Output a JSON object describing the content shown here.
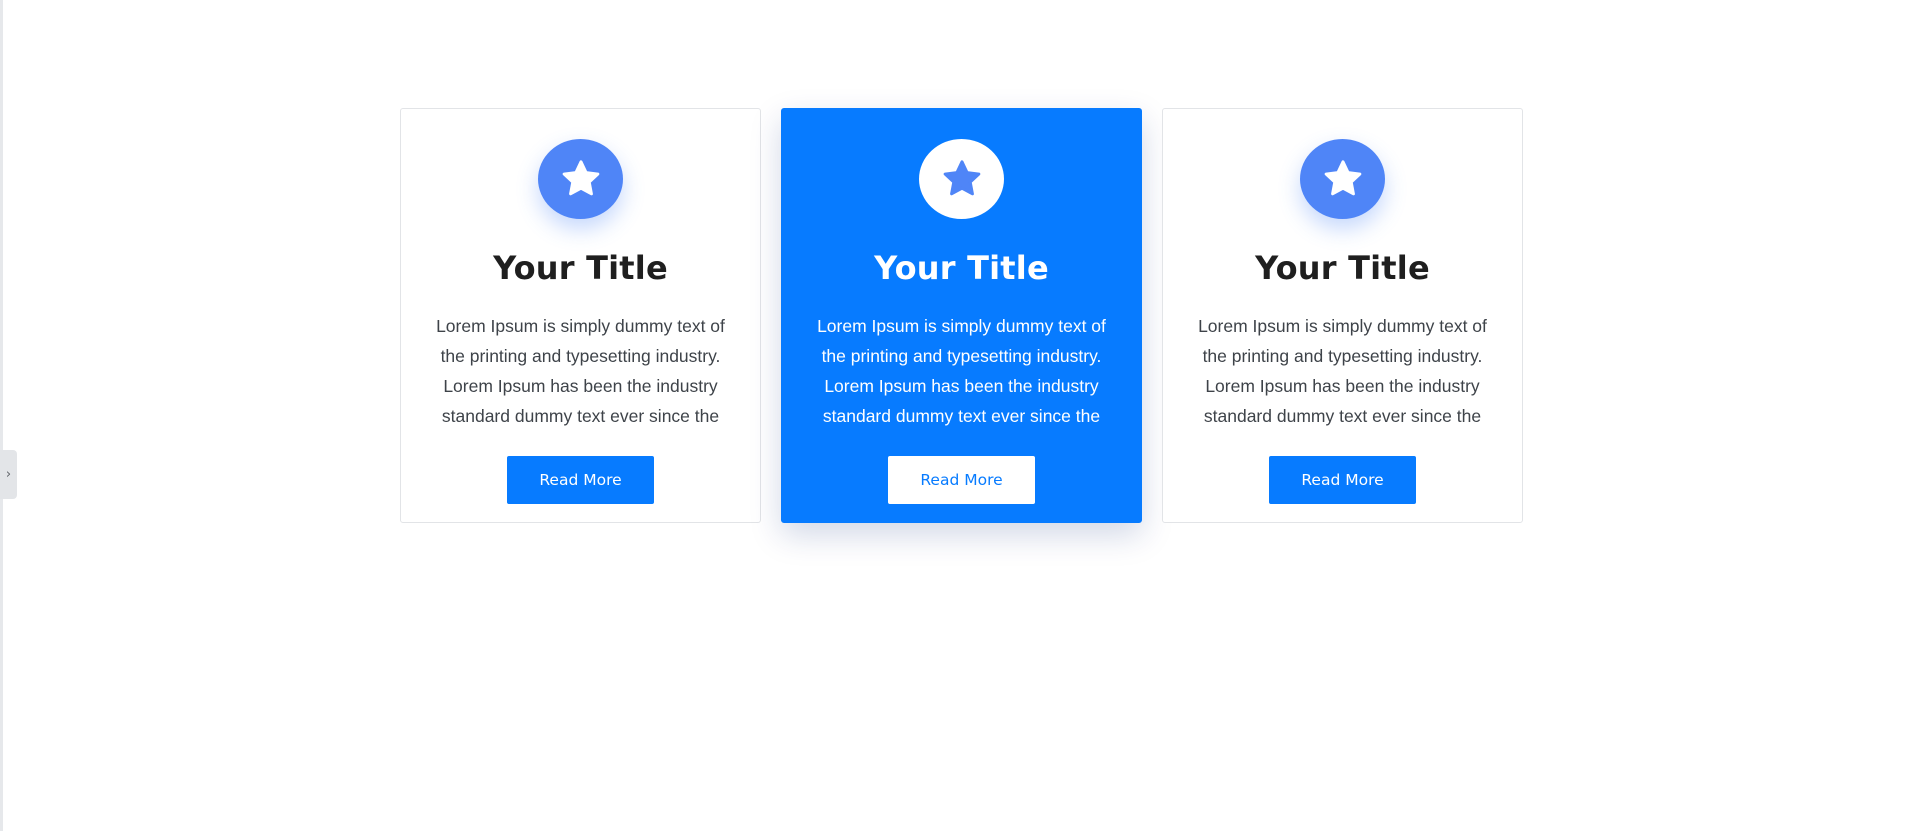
{
  "sidebar_toggle": {
    "glyph": "›"
  },
  "colors": {
    "accent": "#077bff",
    "icon_circle": "#4f85f7",
    "title": "#1f1f1f",
    "body_text": "#3e4349"
  },
  "cards": [
    {
      "icon": "star-icon",
      "title": "Your Title",
      "text": "Lorem Ipsum is simply dummy text of the printing and typesetting industry. Lorem Ipsum has been the industry standard dummy text ever since the",
      "button_label": "Read More",
      "featured": false
    },
    {
      "icon": "star-icon",
      "title": "Your Title",
      "text": "Lorem Ipsum is simply dummy text of the printing and typesetting industry. Lorem Ipsum has been the industry standard dummy text ever since the",
      "button_label": "Read More",
      "featured": true
    },
    {
      "icon": "star-icon",
      "title": "Your Title",
      "text": "Lorem Ipsum is simply dummy text of the printing and typesetting industry. Lorem Ipsum has been the industry standard dummy text ever since the",
      "button_label": "Read More",
      "featured": false
    }
  ]
}
